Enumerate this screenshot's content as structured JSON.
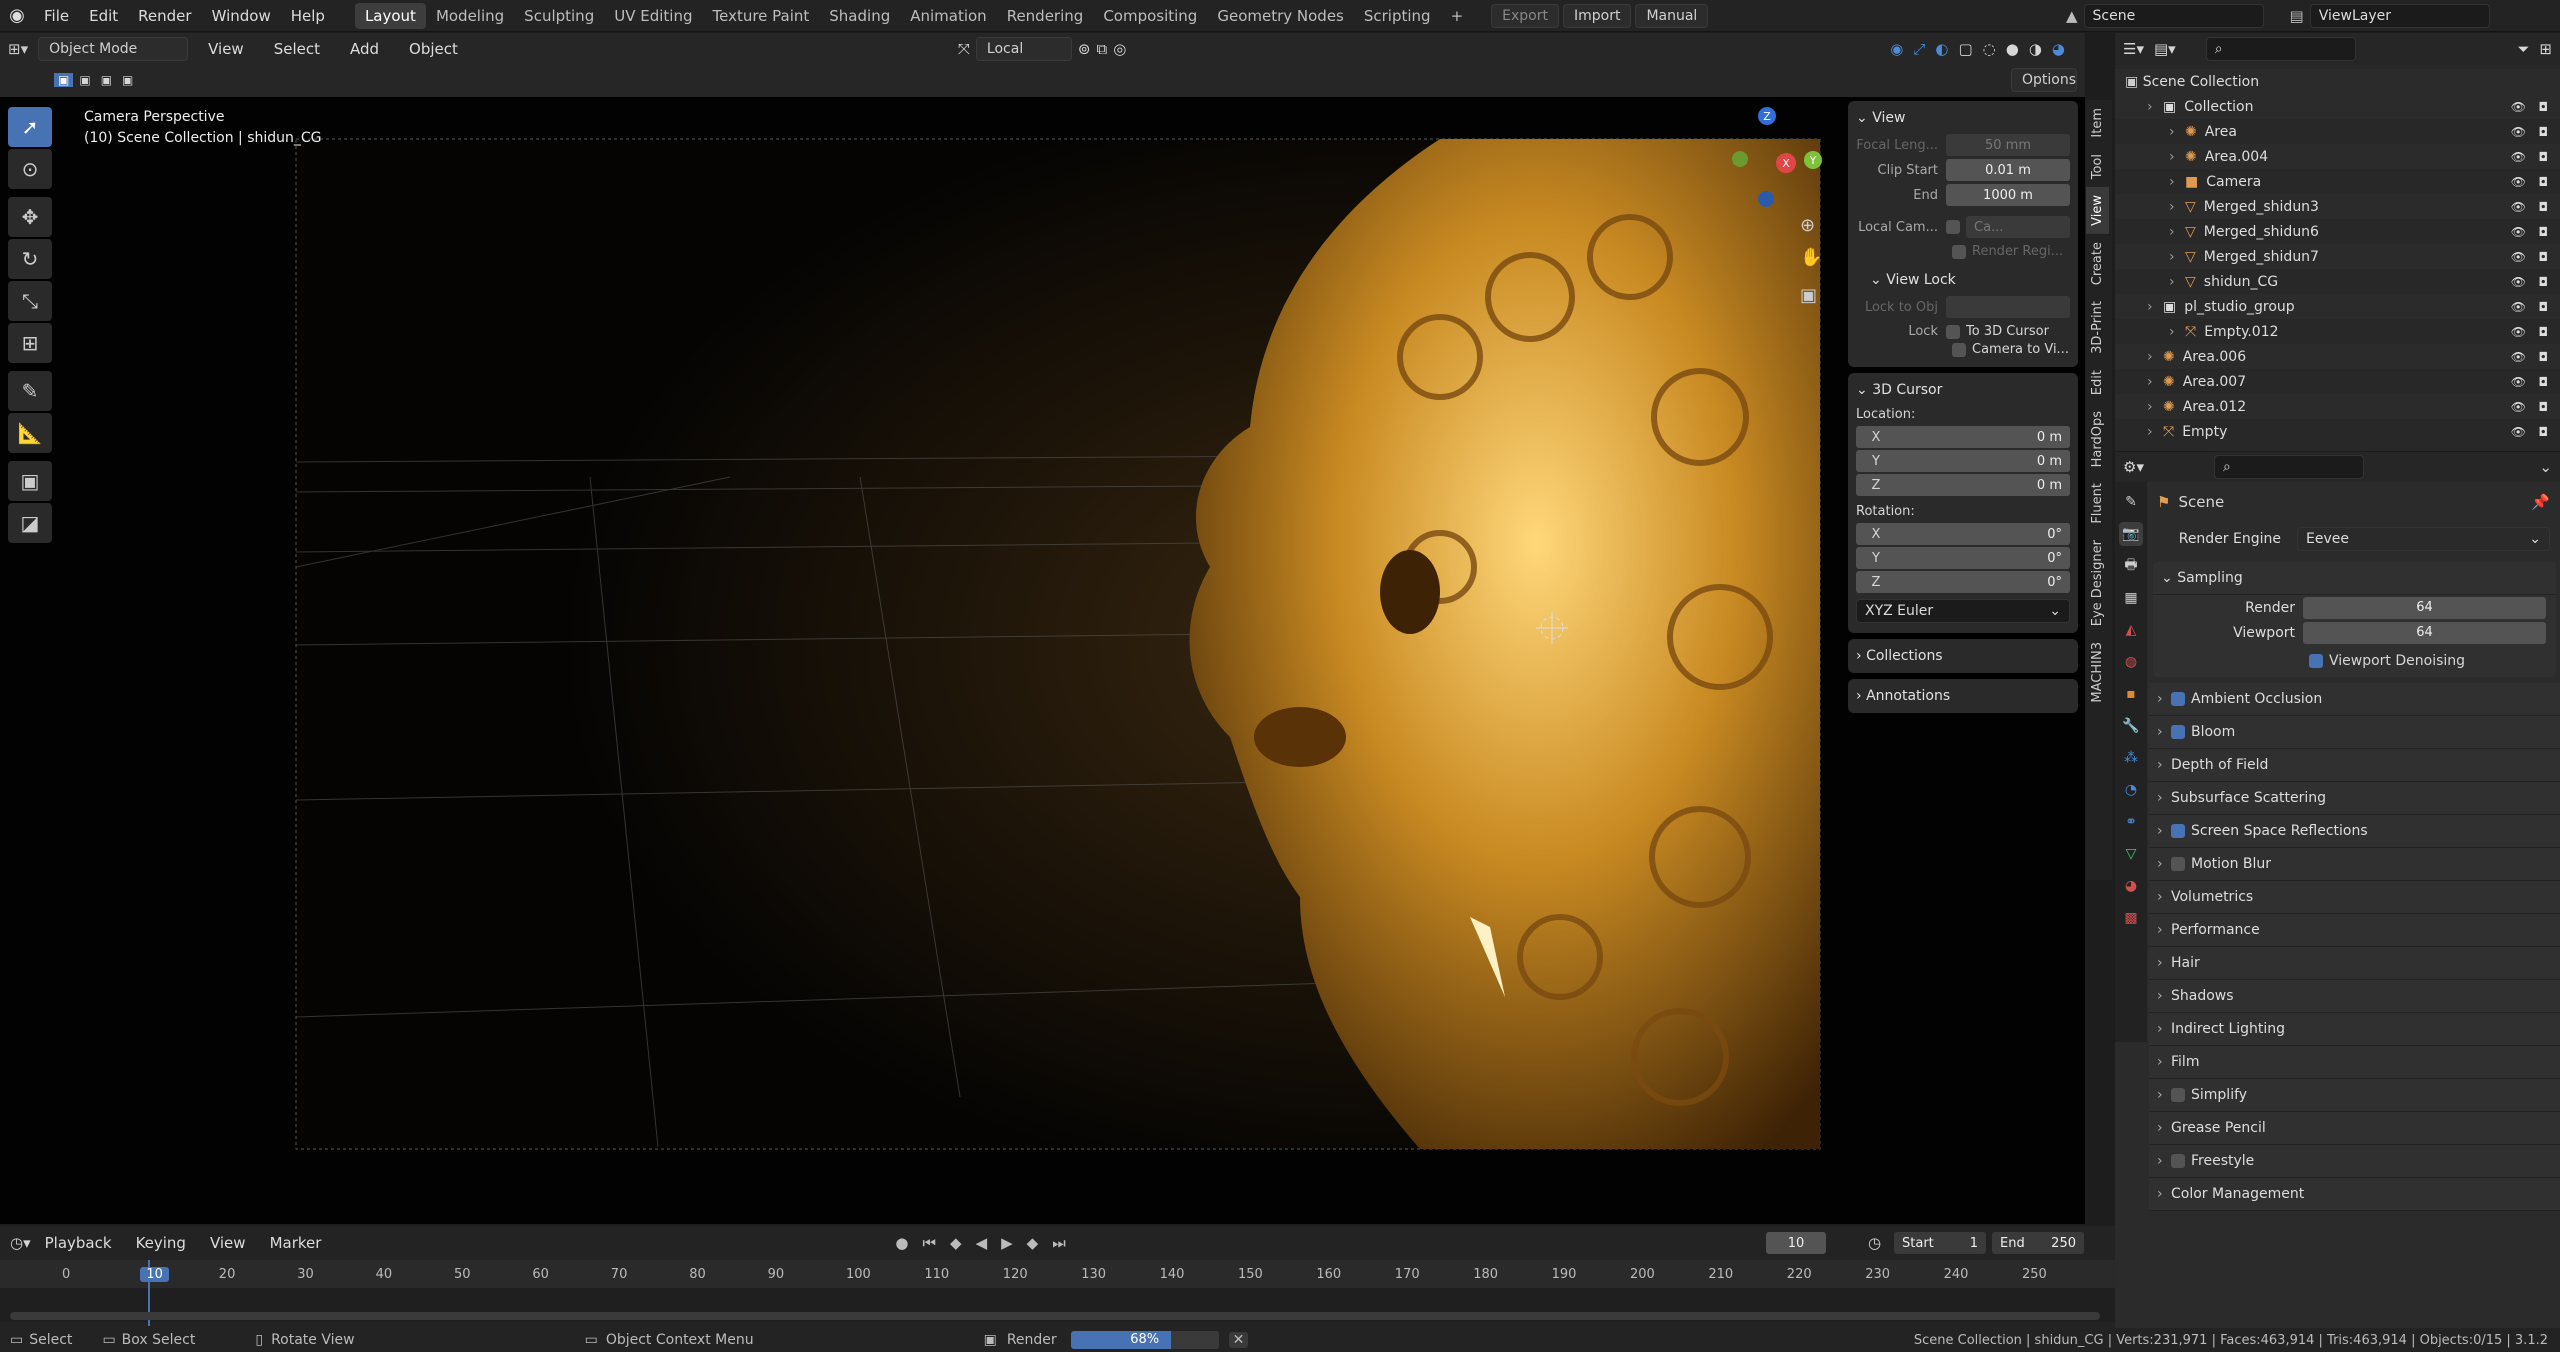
{
  "colors": {
    "accent": "#4772b3",
    "gold": "#e0a83a",
    "bg": "#1d1d1d"
  },
  "topbar": {
    "menus": [
      "File",
      "Edit",
      "Render",
      "Window",
      "Help"
    ],
    "workspaces": [
      "Layout",
      "Modeling",
      "Sculpting",
      "UV Editing",
      "Texture Paint",
      "Shading",
      "Animation",
      "Rendering",
      "Compositing",
      "Geometry Nodes",
      "Scripting"
    ],
    "active_workspace": "Layout",
    "plus": "+",
    "export": "Export",
    "import": "Import",
    "manual": "Manual",
    "scene": "Scene",
    "view_layer": "ViewLayer"
  },
  "viewport_header": {
    "mode": "Object Mode",
    "menus": [
      "View",
      "Select",
      "Add",
      "Object"
    ],
    "orientation": "Local",
    "options": "Options"
  },
  "viewport": {
    "camera_title": "Camera Perspective",
    "collection_info": "(10) Scene Collection | shidun_CG",
    "gizmo": {
      "z": "Z",
      "x": "X",
      "y": "Y"
    }
  },
  "npanel": {
    "view": {
      "title": "View",
      "focal_label": "Focal Leng...",
      "focal_value": "50 mm",
      "clip_start_label": "Clip Start",
      "clip_start": "0.01 m",
      "end_label": "End",
      "end": "1000 m",
      "local_cam_label": "Local Cam...",
      "local_cam_value": "Ca...",
      "render_region": "Render Regi..."
    },
    "view_lock": {
      "title": "View Lock",
      "lock_to_obj": "Lock to Obj",
      "lock_label": "Lock",
      "to_cursor": "To 3D Cursor",
      "camera_to_view": "Camera to Vi..."
    },
    "cursor": {
      "title": "3D Cursor",
      "location": "Location:",
      "lx": "0 m",
      "ly": "0 m",
      "lz": "0 m",
      "rotation": "Rotation:",
      "rx": "0°",
      "ry": "0°",
      "rz": "0°",
      "mode": "XYZ Euler",
      "axes": [
        "X",
        "Y",
        "Z"
      ]
    },
    "collections": "Collections",
    "annotations": "Annotations",
    "tabs": [
      "Item",
      "Tool",
      "View",
      "Create",
      "3D-Print",
      "Edit",
      "HardOps",
      "Fluent",
      "Eye Designer",
      "MACHIN3"
    ],
    "active_tab": "View"
  },
  "outliner": {
    "root": "Scene Collection",
    "rows": [
      {
        "name": "Collection",
        "indent": 1,
        "icon": "collection-icon"
      },
      {
        "name": "Area",
        "indent": 2,
        "icon": "light-icon"
      },
      {
        "name": "Area.004",
        "indent": 2,
        "icon": "light-icon"
      },
      {
        "name": "Camera",
        "indent": 2,
        "icon": "camera-icon"
      },
      {
        "name": "Merged_shidun3",
        "indent": 2,
        "icon": "mesh-icon"
      },
      {
        "name": "Merged_shidun6",
        "indent": 2,
        "icon": "mesh-icon"
      },
      {
        "name": "Merged_shidun7",
        "indent": 2,
        "icon": "mesh-icon"
      },
      {
        "name": "shidun_CG",
        "indent": 2,
        "icon": "mesh-icon"
      },
      {
        "name": "pl_studio_group",
        "indent": 1,
        "icon": "collection-icon"
      },
      {
        "name": "Empty.012",
        "indent": 2,
        "icon": "empty-icon"
      },
      {
        "name": "Area.006",
        "indent": 1,
        "icon": "light-icon"
      },
      {
        "name": "Area.007",
        "indent": 1,
        "icon": "light-icon"
      },
      {
        "name": "Area.012",
        "indent": 1,
        "icon": "light-icon"
      },
      {
        "name": "Empty",
        "indent": 1,
        "icon": "empty-icon"
      }
    ]
  },
  "properties": {
    "scene": "Scene",
    "render_engine_label": "Render Engine",
    "render_engine": "Eevee",
    "sampling": "Sampling",
    "render_label": "Render",
    "render_samples": "64",
    "viewport_label": "Viewport",
    "viewport_samples": "64",
    "denoising": "Viewport Denoising",
    "sections": [
      {
        "label": "Ambient Occlusion",
        "check": "on"
      },
      {
        "label": "Bloom",
        "check": "on"
      },
      {
        "label": "Depth of Field",
        "check": "none"
      },
      {
        "label": "Subsurface Scattering",
        "check": "none"
      },
      {
        "label": "Screen Space Reflections",
        "check": "on"
      },
      {
        "label": "Motion Blur",
        "check": "off"
      },
      {
        "label": "Volumetrics",
        "check": "none"
      },
      {
        "label": "Performance",
        "check": "none"
      },
      {
        "label": "Hair",
        "check": "none"
      },
      {
        "label": "Shadows",
        "check": "none"
      },
      {
        "label": "Indirect Lighting",
        "check": "none"
      },
      {
        "label": "Film",
        "check": "none"
      },
      {
        "label": "Simplify",
        "check": "off"
      },
      {
        "label": "Grease Pencil",
        "check": "none"
      },
      {
        "label": "Freestyle",
        "check": "off"
      },
      {
        "label": "Color Management",
        "check": "none"
      }
    ]
  },
  "timeline": {
    "menus": [
      "Playback",
      "Keying",
      "View",
      "Marker"
    ],
    "current_frame": "10",
    "start_label": "Start",
    "start": "1",
    "end_label": "End",
    "end": "250",
    "ticks": [
      "0",
      "10",
      "20",
      "30",
      "40",
      "50",
      "60",
      "70",
      "80",
      "90",
      "100",
      "110",
      "120",
      "130",
      "140",
      "150",
      "160",
      "170",
      "180",
      "190",
      "200",
      "210",
      "220",
      "230",
      "240",
      "250"
    ]
  },
  "statusbar": {
    "select": "Select",
    "box_select": "Box Select",
    "rotate": "Rotate View",
    "context": "Object Context Menu",
    "render_label": "Render",
    "render_progress": 0.68,
    "render_progress_text": "68%",
    "stats": "Scene Collection | shidun_CG | Verts:231,971 | Faces:463,914 | Tris:463,914 | Objects:0/15 | 3.1.2"
  }
}
